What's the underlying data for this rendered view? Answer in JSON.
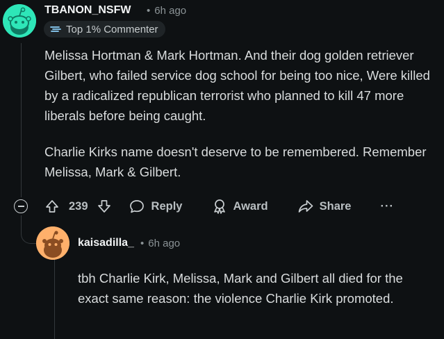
{
  "comment": {
    "username": "TBANON_NSFW",
    "time": "6h ago",
    "separator": "•",
    "badge": {
      "icon": "flying-comment-icon",
      "label": "Top 1% Commenter"
    },
    "paragraphs": [
      "Melissa Hortman & Mark Hortman. And their dog golden retriever Gilbert, who failed service dog school for being too nice, Were killed by a radicalized republican terrorist who planned to kill 47 more liberals before being caught.",
      "Charlie Kirks name doesn't deserve to be remembered. Remember Melissa, Mark & Gilbert."
    ],
    "actions": {
      "vote_count": "239",
      "reply_label": "Reply",
      "award_label": "Award",
      "share_label": "Share",
      "more_label": "···"
    }
  },
  "reply": {
    "username": "kaisadilla_",
    "time": "6h ago",
    "separator": "•",
    "text": "tbh Charlie Kirk, Melissa, Mark and Gilbert all died for the exact same reason: the violence Charlie Kirk promoted."
  },
  "colors": {
    "background": "#0e1113",
    "avatar_main": "#2ee6b8",
    "avatar_reply": "#ffb06b",
    "thread_line": "#33383b"
  }
}
